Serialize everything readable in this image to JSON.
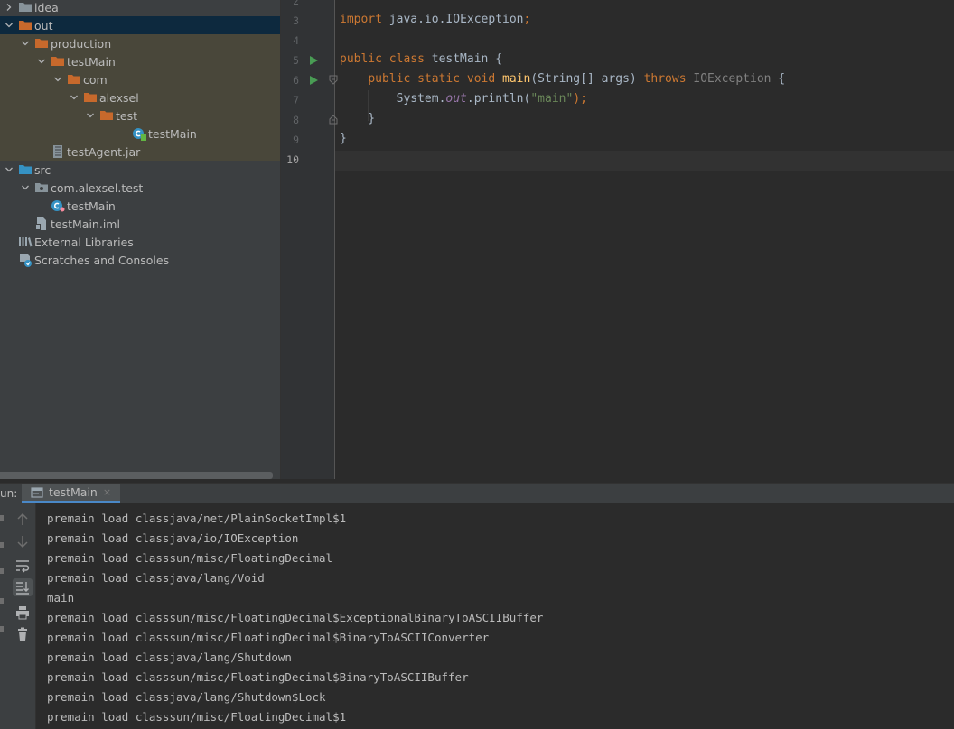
{
  "project_tree": {
    "rows": [
      {
        "label": "idea",
        "icon": "folder-icon",
        "indent": 0,
        "arrow": "right",
        "state": ""
      },
      {
        "label": "out",
        "icon": "folder-orange-icon",
        "indent": 0,
        "arrow": "down",
        "state": "selected"
      },
      {
        "label": "production",
        "icon": "folder-orange-icon",
        "indent": 1,
        "arrow": "down",
        "state": "excluded"
      },
      {
        "label": "testMain",
        "icon": "folder-orange-icon",
        "indent": 2,
        "arrow": "down",
        "state": "excluded"
      },
      {
        "label": "com",
        "icon": "folder-orange-icon",
        "indent": 3,
        "arrow": "down",
        "state": "excluded"
      },
      {
        "label": "alexsel",
        "icon": "folder-orange-icon",
        "indent": 4,
        "arrow": "down",
        "state": "excluded"
      },
      {
        "label": "test",
        "icon": "folder-orange-icon",
        "indent": 5,
        "arrow": "down",
        "state": "excluded"
      },
      {
        "label": "testMain",
        "icon": "class-file-icon",
        "indent": 7,
        "arrow": "none",
        "state": "excluded"
      },
      {
        "label": "testAgent.jar",
        "icon": "jar-file-icon",
        "indent": 2,
        "arrow": "none",
        "state": "excluded"
      },
      {
        "label": "src",
        "icon": "source-folder-icon",
        "indent": 0,
        "arrow": "down",
        "state": ""
      },
      {
        "label": "com.alexsel.test",
        "icon": "package-icon",
        "indent": 1,
        "arrow": "down",
        "state": ""
      },
      {
        "label": "testMain",
        "icon": "java-class-icon",
        "indent": 2,
        "arrow": "none",
        "state": ""
      },
      {
        "label": "testMain.iml",
        "icon": "iml-file-icon",
        "indent": 1,
        "arrow": "none",
        "state": ""
      },
      {
        "label": "External Libraries",
        "icon": "libraries-icon",
        "indent": 0,
        "arrow": "none",
        "state": ""
      },
      {
        "label": "Scratches and Consoles",
        "icon": "scratches-icon",
        "indent": 0,
        "arrow": "none",
        "state": ""
      }
    ]
  },
  "editor": {
    "line_numbers": [
      "2",
      "3",
      "4",
      "5",
      "6",
      "7",
      "8",
      "9",
      "10"
    ],
    "current_line": "10",
    "lines": [
      [],
      [
        {
          "t": "import ",
          "c": "kw"
        },
        {
          "t": "java.io.IOException",
          "c": "plain"
        },
        {
          "t": ";",
          "c": "kw"
        }
      ],
      [],
      [
        {
          "t": "public class ",
          "c": "kw"
        },
        {
          "t": "testMain {",
          "c": "plain"
        }
      ],
      [
        {
          "t": "    ",
          "c": "plain"
        },
        {
          "t": "public static void ",
          "c": "kw"
        },
        {
          "t": "main",
          "c": "fn"
        },
        {
          "t": "(String[] args) ",
          "c": "plain"
        },
        {
          "t": "throws ",
          "c": "kw"
        },
        {
          "t": "IOException",
          "c": "grey"
        },
        {
          "t": " {",
          "c": "plain"
        }
      ],
      [
        {
          "t": "        System.",
          "c": "plain"
        },
        {
          "t": "out",
          "c": "field"
        },
        {
          "t": ".println(",
          "c": "plain"
        },
        {
          "t": "\"main\"",
          "c": "str"
        },
        {
          "t": ");",
          "c": "kw"
        }
      ],
      [
        {
          "t": "    }",
          "c": "plain"
        }
      ],
      [
        {
          "t": "}",
          "c": "plain"
        }
      ],
      []
    ]
  },
  "run_window": {
    "label": "un:",
    "tab_label": "testMain",
    "tab_close": "×",
    "console_lines": [
      "premain load classjava/net/PlainSocketImpl$1",
      "premain load classjava/io/IOException",
      "premain load classsun/misc/FloatingDecimal",
      "premain load classjava/lang/Void",
      "main",
      "premain load classsun/misc/FloatingDecimal$ExceptionalBinaryToASCIIBuffer",
      "premain load classsun/misc/FloatingDecimal$BinaryToASCIIConverter",
      "premain load classjava/lang/Shutdown",
      "premain load classsun/misc/FloatingDecimal$BinaryToASCIIBuffer",
      "premain load classjava/lang/Shutdown$Lock",
      "premain load classsun/misc/FloatingDecimal$1"
    ],
    "toolbar_buttons": [
      {
        "icon": "arrow-up-icon",
        "active": false
      },
      {
        "icon": "arrow-down-icon",
        "active": false
      },
      {
        "icon": "soft-wrap-icon",
        "active": false
      },
      {
        "icon": "scroll-to-end-icon",
        "active": true
      },
      {
        "icon": "print-icon",
        "active": false
      },
      {
        "icon": "trash-icon",
        "active": false
      }
    ]
  },
  "colors": {
    "tree_bg": "#3c3f41",
    "editor_bg": "#2b2b2b",
    "selected_row": "#0d293e",
    "excluded_row": "#49473a",
    "keyword": "#cc7832",
    "string": "#6a8759",
    "function": "#ffc66d",
    "field": "#9876aa",
    "run_green": "#499c54",
    "folder_orange": "#c7692c"
  }
}
